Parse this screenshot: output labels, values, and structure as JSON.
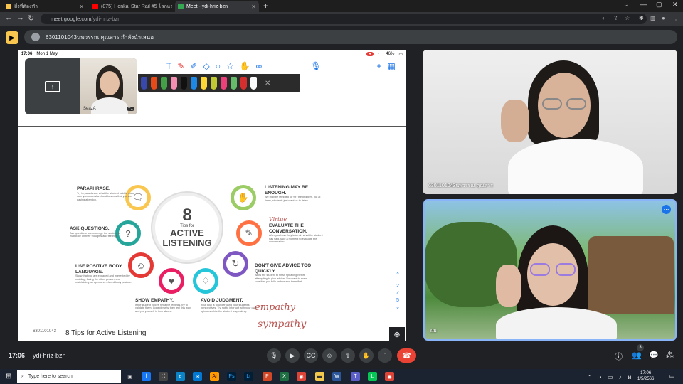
{
  "browser": {
    "tabs": [
      {
        "label": "สิ่งที่ต้องทำ",
        "color": "#f9c74f"
      },
      {
        "label": "(875) Honkai Star Rail #5 โลกแลกเปลี่ยน...",
        "color": "#ff0000"
      },
      {
        "label": "Meet - ydi-hriz-bzn",
        "color": "#34a853"
      }
    ],
    "new_tab": "+",
    "url_host": "meet.google.com",
    "url_path": "/ydi-hriz-bzn"
  },
  "presenting": {
    "banner": "6301101043นพวรรณ คุณสาร กำลังนำเสนอ"
  },
  "ipad": {
    "time": "17:06",
    "date": "Mon 1 May",
    "battery": "46%"
  },
  "pip": {
    "name": "SeazA",
    "count": "+1"
  },
  "slide": {
    "center_number": "8",
    "center_sub": "Tips for",
    "center_title": "ACTIVE LISTENING",
    "tips": [
      {
        "title": "PARAPHRASE.",
        "body": "Try to paraphrase what the student said to make sure you understand and to show that you are paying attention."
      },
      {
        "title": "ASK QUESTIONS.",
        "body": "Ask questions to encourage the student to elaborate on their thoughts and feelings."
      },
      {
        "title": "USE POSITIVE BODY LANGUAGE.",
        "body": "Show that you are engaged and interested by nodding, facing the other person, and maintaining an open and relaxed body posture."
      },
      {
        "title": "SHOW EMPATHY.",
        "body": "If the student voices negative feelings, try to validate them. Consider why they feel this way and put yourself in their shoes."
      },
      {
        "title": "AVOID JUDGMENT.",
        "body": "Your goal is to understand your student's perspectives. Try not to interrupt with your own opinions while the student is speaking."
      },
      {
        "title": "DON'T GIVE ADVICE TOO QUICKLY.",
        "body": "Allow the student to finish speaking before attempting to give advice. You want to make sure that you fully understand them first."
      },
      {
        "title": "EVALUATE THE CONVERSATION.",
        "body": "After you have fully taken in what the student has said, take a moment to evaluate the conversation."
      },
      {
        "title": "LISTENING MAY BE ENOUGH.",
        "body": "We may be tempted to \"fix\" the problem, but at times, students just want us to listen."
      }
    ],
    "handwriting": [
      "Virtue",
      "empathy",
      "sympathy"
    ],
    "caption": "8 Tips for Active Listening",
    "owner": "6301101043",
    "page_current": "2",
    "page_total": "5"
  },
  "tiles": [
    {
      "name": "6301101043นพวรรณ คุณสาร"
    },
    {
      "name": "ผม"
    }
  ],
  "meet": {
    "time": "17:06",
    "code": "ydi-hriz-bzn",
    "participants": "3"
  },
  "taskbar": {
    "search_placeholder": "Type here to search",
    "time": "17:06",
    "date": "1/5/2566"
  },
  "colors": {
    "accent": "#8ab4f8",
    "end_call": "#ea4335",
    "presenting_icon": "#f9c74f"
  }
}
